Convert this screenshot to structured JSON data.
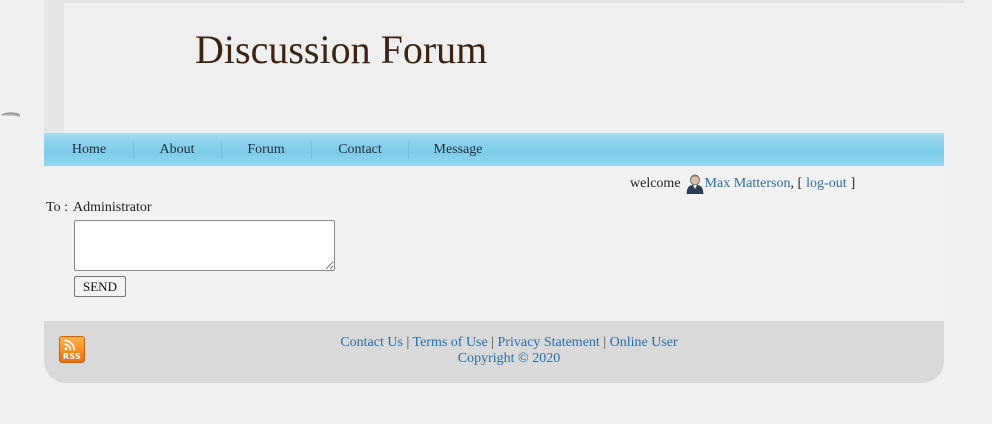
{
  "site": {
    "title": "Discussion Forum"
  },
  "nav": {
    "items": [
      {
        "label": "Home"
      },
      {
        "label": "About"
      },
      {
        "label": "Forum"
      },
      {
        "label": "Contact"
      },
      {
        "label": "Message"
      }
    ]
  },
  "welcome": {
    "prefix": "welcome",
    "user_name": "Max Matterson",
    "open_bracket": ", [",
    "logout_label": "log-out",
    "close_bracket": "]"
  },
  "message_form": {
    "to_label": "To :",
    "to_value": "Administrator",
    "message_value": "",
    "send_label": "SEND"
  },
  "footer": {
    "links": [
      {
        "label": "Contact Us"
      },
      {
        "label": "Terms of Use"
      },
      {
        "label": "Privacy Statement"
      },
      {
        "label": "Online User"
      }
    ],
    "separator": "|",
    "copyright": "Copyright © 2020",
    "rss_label": "RSS"
  },
  "colors": {
    "title": "#3b2413",
    "link": "#2b6da6",
    "nav_bar": "#7ccbe8",
    "rss": "#f58a1f",
    "footer_bg": "#d9d9d9"
  },
  "icons": {
    "user": "user-icon",
    "rss": "rss-icon",
    "arrow": "arrow-left-icon"
  }
}
